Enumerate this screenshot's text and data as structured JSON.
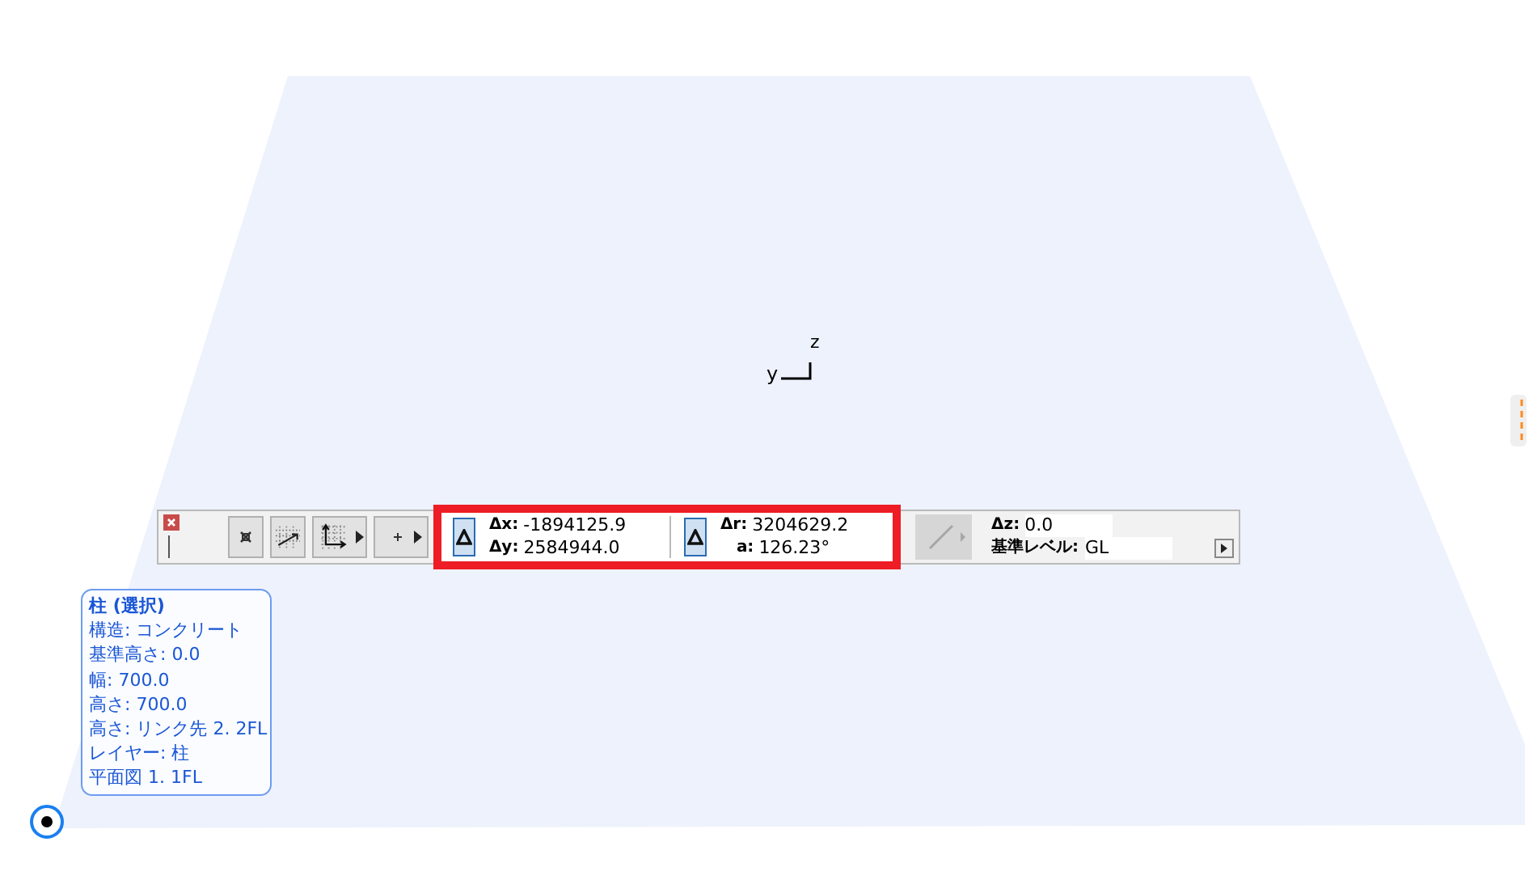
{
  "axis": {
    "z": "z",
    "y": "y"
  },
  "coord_bar": {
    "cartesian": [
      {
        "label": "Δx:",
        "value": "-1894125.9"
      },
      {
        "label": "Δy:",
        "value": "2584944.0"
      }
    ],
    "polar": [
      {
        "label": "Δr:",
        "value": "3204629.2"
      },
      {
        "label": "a:",
        "value": "126.23°"
      }
    ],
    "elevation": [
      {
        "label": "Δz:",
        "value": "0.0"
      },
      {
        "label": "基準レベル:",
        "value": "GL"
      }
    ],
    "cartesian_relative": true,
    "polar_relative": true,
    "highlighted": true,
    "line_tool_disabled": true
  },
  "info_tag": [
    "柱 (選択)",
    "構造: コンクリート",
    "基準高さ: 0.0",
    "幅: 700.0",
    "高さ: 700.0",
    "高さ: リンク先 2. 2FL",
    "レイヤー: 柱",
    "平面図 1. 1FL"
  ]
}
